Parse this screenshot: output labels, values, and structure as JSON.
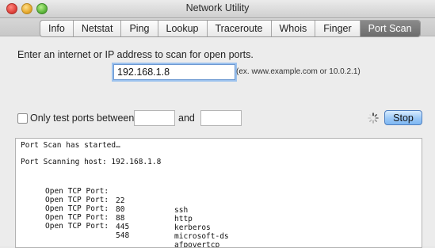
{
  "window": {
    "title": "Network Utility"
  },
  "tabs": [
    {
      "label": "Info",
      "active": false
    },
    {
      "label": "Netstat",
      "active": false
    },
    {
      "label": "Ping",
      "active": false
    },
    {
      "label": "Lookup",
      "active": false
    },
    {
      "label": "Traceroute",
      "active": false
    },
    {
      "label": "Whois",
      "active": false
    },
    {
      "label": "Finger",
      "active": false
    },
    {
      "label": "Port Scan",
      "active": true
    }
  ],
  "scan": {
    "prompt": "Enter an internet or IP address to scan for open ports.",
    "address_value": "192.168.1.8",
    "hint": "(ex. www.example.com or 10.0.2.1)",
    "range_checkbox_label": "Only test ports between",
    "range_checked": false,
    "and_label": "and",
    "port_from": "",
    "port_to": "",
    "stop_label": "Stop",
    "spinner_icon": "progress-spinner-icon"
  },
  "output": {
    "started": "Port Scan has started…",
    "host_line": "Port Scanning host: 192.168.1.8",
    "ports": [
      {
        "label": "Open TCP Port:",
        "port": "22",
        "service": "ssh"
      },
      {
        "label": "Open TCP Port:",
        "port": "80",
        "service": "http"
      },
      {
        "label": "Open TCP Port:",
        "port": "88",
        "service": "kerberos"
      },
      {
        "label": "Open TCP Port:",
        "port": "445",
        "service": "microsoft-ds"
      },
      {
        "label": "Open TCP Port:",
        "port": "548",
        "service": "afpovertcp"
      }
    ]
  }
}
